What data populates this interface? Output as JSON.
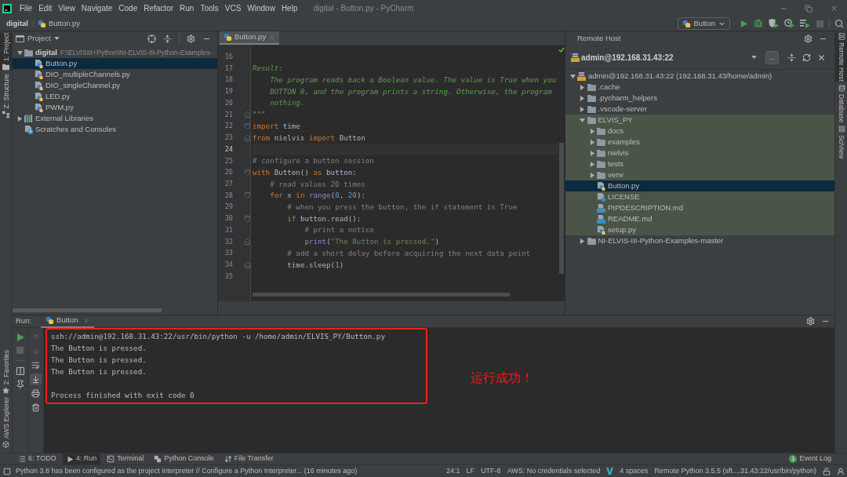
{
  "window": {
    "menu": [
      "File",
      "Edit",
      "View",
      "Navigate",
      "Code",
      "Refactor",
      "Run",
      "Tools",
      "VCS",
      "Window",
      "Help"
    ],
    "title": "digital - Button.py - PyCharm"
  },
  "nav_bar": {
    "breadcrumbs": [
      "digital",
      "Button.py"
    ],
    "run_config": "Button",
    "toolbar": [
      {
        "kind": "run",
        "disabled": false
      },
      {
        "kind": "debug",
        "disabled": false
      },
      {
        "kind": "coverage",
        "disabled": false
      },
      {
        "kind": "profile",
        "disabled": false
      },
      {
        "kind": "concurrency",
        "disabled": false
      },
      {
        "kind": "stop",
        "disabled": true
      }
    ]
  },
  "left_stripe": {
    "top": [
      {
        "label": "1: Project",
        "kind": "project",
        "selected": true
      },
      {
        "label": "Z: Structure",
        "kind": "structure",
        "selected": false
      }
    ],
    "bottom": [
      {
        "label": "2: Favorites",
        "kind": "favorites",
        "selected": false
      },
      {
        "label": "AWS Explorer",
        "kind": "aws",
        "selected": false
      }
    ]
  },
  "project_panel": {
    "title": "Project",
    "tree": [
      {
        "name": "digital",
        "path": "F:\\ELVISIII+Python\\NI-ELVIS-III-Python-Examples-",
        "kind": "project",
        "expanded": true,
        "selected": false,
        "children": [
          {
            "name": "Button.py",
            "kind": "python",
            "selected": true
          },
          {
            "name": "DIO_multipleChannels.py",
            "kind": "python",
            "selected": false
          },
          {
            "name": "DIO_singleChannel.py",
            "kind": "python",
            "selected": false
          },
          {
            "name": "LED.py",
            "kind": "python",
            "selected": false
          },
          {
            "name": "PWM.py",
            "kind": "python",
            "selected": false
          }
        ]
      },
      {
        "name": "External Libraries",
        "kind": "library",
        "expanded": false,
        "selected": false
      },
      {
        "name": "Scratches and Consoles",
        "kind": "scratches",
        "selected": false
      }
    ]
  },
  "editor": {
    "tab": {
      "label": "Button.py",
      "selected": true
    },
    "lines": [
      {
        "number": "16",
        "kind": "line",
        "current": false
      },
      {
        "number": "17",
        "kind": "line",
        "current": false,
        "tokens": [
          {
            "text": "Result:",
            "kind": "docstring"
          }
        ]
      },
      {
        "number": "18",
        "kind": "line",
        "current": false,
        "tokens": [
          {
            "text": "    The program reads back a Boolean value. The value is True when you",
            "kind": "docstring"
          }
        ]
      },
      {
        "number": "19",
        "kind": "line",
        "current": false,
        "tokens": [
          {
            "text": "    BUTTON 0, and the program prints a string. Otherwise, the program",
            "kind": "docstring"
          }
        ]
      },
      {
        "number": "20",
        "kind": "line",
        "current": false,
        "tokens": [
          {
            "text": "    nothing.",
            "kind": "docstring"
          }
        ]
      },
      {
        "number": "21",
        "kind": "fold_end",
        "current": false,
        "tokens": [
          {
            "text": "\"\"\"",
            "kind": "docstring"
          }
        ]
      },
      {
        "number": "22",
        "kind": "fold_start",
        "current": false,
        "tokens": [
          {
            "text": "import",
            "kind": "keyword"
          },
          {
            "text": " time",
            "kind": "plain"
          }
        ]
      },
      {
        "number": "23",
        "kind": "fold_end",
        "current": false,
        "tokens": [
          {
            "text": "from",
            "kind": "keyword"
          },
          {
            "text": " nielvis ",
            "kind": "plain"
          },
          {
            "text": "import",
            "kind": "keyword"
          },
          {
            "text": " Button",
            "kind": "plain"
          }
        ]
      },
      {
        "number": "24",
        "kind": "line",
        "current": true
      },
      {
        "number": "25",
        "kind": "line",
        "current": false,
        "tokens": [
          {
            "text": "# configure a button session",
            "kind": "comment"
          }
        ]
      },
      {
        "number": "26",
        "kind": "fold_start",
        "current": false,
        "tokens": [
          {
            "text": "with",
            "kind": "keyword"
          },
          {
            "text": " Button() ",
            "kind": "plain"
          },
          {
            "text": "as",
            "kind": "keyword"
          },
          {
            "text": " button:",
            "kind": "plain"
          }
        ]
      },
      {
        "number": "27",
        "kind": "line",
        "current": false,
        "tokens": [
          {
            "text": "    # read values 20 times",
            "kind": "comment"
          }
        ]
      },
      {
        "number": "28",
        "kind": "fold_start",
        "current": false,
        "tokens": [
          {
            "text": "    for",
            "kind": "keyword"
          },
          {
            "text": " x ",
            "kind": "plain"
          },
          {
            "text": "in",
            "kind": "keyword"
          },
          {
            "text": " range",
            "kind": "builtin"
          },
          {
            "text": "(",
            "kind": "plain"
          },
          {
            "text": "0",
            "kind": "number"
          },
          {
            "text": ", ",
            "kind": "plain"
          },
          {
            "text": "20",
            "kind": "number"
          },
          {
            "text": "):",
            "kind": "plain"
          }
        ]
      },
      {
        "number": "29",
        "kind": "line",
        "current": false,
        "tokens": [
          {
            "text": "        # when you press the button, the if statement is True",
            "kind": "comment"
          }
        ]
      },
      {
        "number": "30",
        "kind": "fold_start",
        "current": false,
        "tokens": [
          {
            "text": "        if",
            "kind": "keyword"
          },
          {
            "text": " button.read():",
            "kind": "plain"
          }
        ]
      },
      {
        "number": "31",
        "kind": "line",
        "current": false,
        "tokens": [
          {
            "text": "            # print a notice",
            "kind": "comment"
          }
        ]
      },
      {
        "number": "32",
        "kind": "fold_end",
        "current": false,
        "tokens": [
          {
            "text": "            print",
            "kind": "builtin"
          },
          {
            "text": "(",
            "kind": "plain"
          },
          {
            "text": "\"The Button is pressed.\"",
            "kind": "string"
          },
          {
            "text": ")",
            "kind": "plain"
          }
        ]
      },
      {
        "number": "33",
        "kind": "line",
        "current": false,
        "tokens": [
          {
            "text": "        # add a short delay before acquiring the next data point",
            "kind": "comment"
          }
        ]
      },
      {
        "number": "34",
        "kind": "fold_end",
        "current": false,
        "tokens": [
          {
            "text": "        time.sleep(",
            "kind": "plain"
          },
          {
            "text": "1",
            "kind": "number"
          },
          {
            "text": ")",
            "kind": "plain"
          }
        ]
      },
      {
        "number": "35",
        "kind": "line",
        "current": false
      }
    ]
  },
  "remote_host": {
    "title": "Remote Host",
    "connection": "admin@192.168.31.43:22",
    "more_button": "...",
    "tree": [
      {
        "name": "admin@192.168.31.43:22 (192.168.31.43/home/admin)",
        "kind": "server",
        "expanded": true,
        "selected": false,
        "highlighted": false,
        "children": [
          {
            "name": ".cache",
            "kind": "folder",
            "expanded": false,
            "selected": false,
            "highlighted": false
          },
          {
            "name": ".pycharm_helpers",
            "kind": "folder",
            "expanded": false,
            "selected": false,
            "highlighted": false
          },
          {
            "name": ".vscode-server",
            "kind": "folder",
            "expanded": false,
            "selected": false,
            "highlighted": false
          },
          {
            "name": "ELVIS_PY",
            "kind": "folder",
            "expanded": true,
            "selected": false,
            "highlighted": true,
            "children": [
              {
                "name": "docs",
                "kind": "folder",
                "expanded": false,
                "selected": false,
                "highlighted": true
              },
              {
                "name": "examples",
                "kind": "folder",
                "expanded": false,
                "selected": false,
                "highlighted": true
              },
              {
                "name": "nielvis",
                "kind": "folder",
                "expanded": false,
                "selected": false,
                "highlighted": true
              },
              {
                "name": "tests",
                "kind": "folder",
                "expanded": false,
                "selected": false,
                "highlighted": true
              },
              {
                "name": "venv",
                "kind": "folder",
                "expanded": false,
                "selected": false,
                "highlighted": true
              },
              {
                "name": "Button.py",
                "kind": "python",
                "selected": true,
                "highlighted": true
              },
              {
                "name": "LICENSE",
                "kind": "unknown",
                "selected": false,
                "highlighted": true
              },
              {
                "name": "PIPDESCRIPTION.md",
                "kind": "markdown",
                "selected": false,
                "highlighted": true
              },
              {
                "name": "README.md",
                "kind": "markdown",
                "selected": false,
                "highlighted": true
              },
              {
                "name": "setup.py",
                "kind": "python",
                "selected": false,
                "highlighted": true
              }
            ]
          },
          {
            "name": "NI-ELVIS-III-Python-Examples-master",
            "kind": "folder",
            "expanded": false,
            "selected": false,
            "highlighted": false
          }
        ]
      }
    ]
  },
  "right_stripe": [
    {
      "label": "Remote Host",
      "kind": "remote_host",
      "selected": true
    },
    {
      "label": "Database",
      "kind": "database",
      "selected": false
    },
    {
      "label": "SciView",
      "kind": "sciview",
      "selected": false
    }
  ],
  "run_panel": {
    "label": "Run:",
    "tab": {
      "label": "Button",
      "selected": true
    },
    "run_toolbar": [
      {
        "kind": "rerun",
        "disabled": false
      },
      {
        "kind": "stop",
        "disabled": true
      },
      {
        "kind": "layout",
        "disabled": false
      },
      {
        "kind": "pin",
        "disabled": false
      }
    ],
    "console_toolbar": [
      {
        "kind": "up",
        "disabled": true
      },
      {
        "kind": "down",
        "disabled": true
      },
      {
        "kind": "soft_wrap",
        "on": false
      },
      {
        "kind": "scroll_to_end",
        "on": true
      },
      {
        "kind": "print"
      },
      {
        "kind": "clear"
      }
    ],
    "console": {
      "lines": [
        "ssh://admin@192.168.31.43:22/usr/bin/python -u /home/admin/ELVIS_PY/Button.py",
        "The Button is pressed.",
        "The Button is pressed.",
        "The Button is pressed."
      ],
      "exit_message": "Process finished with exit code 0"
    },
    "annotation": "运行成功！"
  },
  "tool_tabs": [
    {
      "label": "6: TODO",
      "kind": "todo",
      "selected": false
    },
    {
      "label": "4: Run",
      "kind": "run",
      "selected": true
    },
    {
      "label": "Terminal",
      "kind": "terminal",
      "selected": false
    },
    {
      "label": "Python Console",
      "kind": "python_console",
      "selected": false
    },
    {
      "label": "File Transfer",
      "kind": "file_transfer",
      "selected": false
    }
  ],
  "event_log": {
    "label": "Event Log",
    "count": "1"
  },
  "status_bar": {
    "message": "Python 3.8 has been configured as the project interpreter // Configure a Python Interpreter... (16 minutes ago)",
    "position": "24:1",
    "line_separator": "LF",
    "encoding": "UTF-8",
    "aws": "AWS: No credentials selected",
    "indent": "4 spaces",
    "interpreter": "Remote Python 3.5.5 (sft....31.43:22/usr/bin/python)"
  }
}
